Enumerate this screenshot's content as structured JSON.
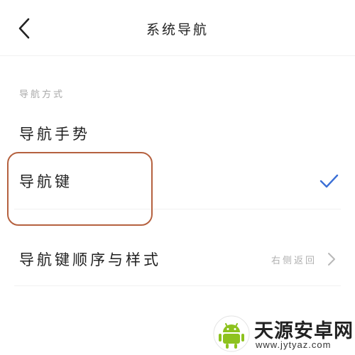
{
  "header": {
    "title": "系统导航",
    "back_icon": "chevron-left-icon"
  },
  "section": {
    "title": "导航方式"
  },
  "options": [
    {
      "label": "导航手势",
      "selected": false
    },
    {
      "label": "导航键",
      "selected": true,
      "check_icon": "checkmark-icon",
      "check_color": "#3b6fd6"
    }
  ],
  "order_row": {
    "label": "导航键顺序与样式",
    "value": "右侧返回",
    "chevron_icon": "chevron-right-icon"
  },
  "highlight": {
    "color": "#b5613f"
  },
  "watermark": {
    "name": "天源安卓网",
    "url": "www.jytyaz.com",
    "logo_icon": "android-robot-icon",
    "logo_color": "#8dc21f"
  }
}
